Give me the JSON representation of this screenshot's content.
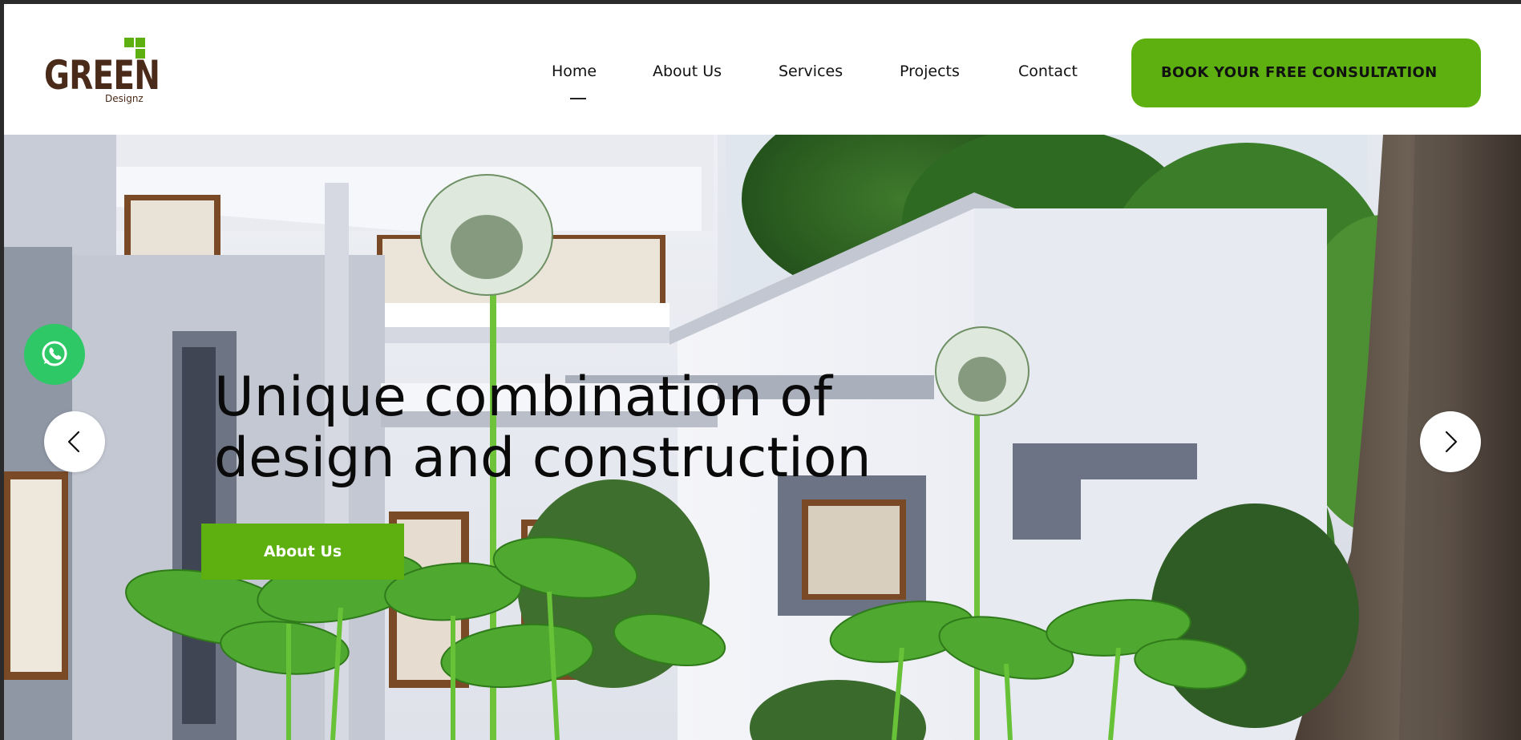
{
  "brand": {
    "name": "GREEN",
    "sub": "Designz",
    "accent": "#5db010",
    "text_color": "#4a2a18"
  },
  "nav": {
    "items": [
      {
        "label": "Home",
        "active": true
      },
      {
        "label": "About Us"
      },
      {
        "label": "Services"
      },
      {
        "label": "Projects"
      },
      {
        "label": "Contact"
      }
    ]
  },
  "cta": {
    "label": "BOOK YOUR FREE CONSULTATION"
  },
  "hero": {
    "headline_line1": "Unique combination of",
    "headline_line2": "design and construction",
    "button_label": "About Us",
    "prev_icon": "chevron-left-icon",
    "next_icon": "chevron-right-icon"
  },
  "floating": {
    "whatsapp_icon": "whatsapp-icon",
    "whatsapp_color": "#2ec866"
  }
}
